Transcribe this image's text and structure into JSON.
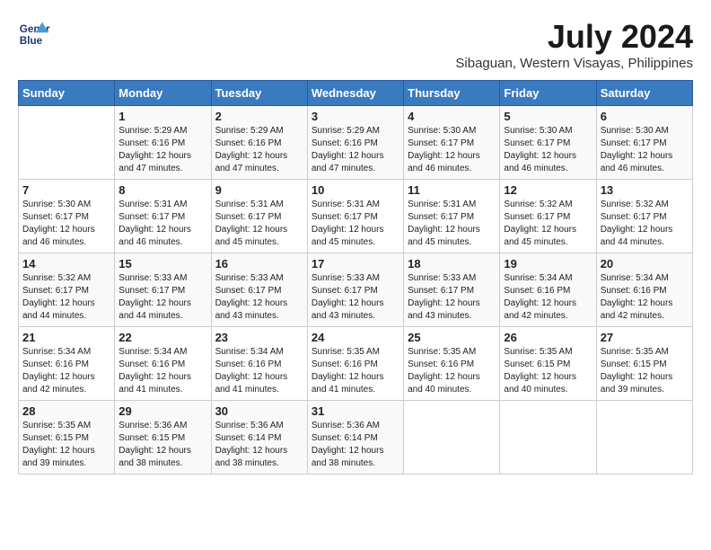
{
  "header": {
    "logo_line1": "General",
    "logo_line2": "Blue",
    "title": "July 2024",
    "subtitle": "Sibaguan, Western Visayas, Philippines"
  },
  "columns": [
    "Sunday",
    "Monday",
    "Tuesday",
    "Wednesday",
    "Thursday",
    "Friday",
    "Saturday"
  ],
  "weeks": [
    [
      {
        "day": "",
        "data": ""
      },
      {
        "day": "1",
        "data": "Sunrise: 5:29 AM\nSunset: 6:16 PM\nDaylight: 12 hours and 47 minutes."
      },
      {
        "day": "2",
        "data": "Sunrise: 5:29 AM\nSunset: 6:16 PM\nDaylight: 12 hours and 47 minutes."
      },
      {
        "day": "3",
        "data": "Sunrise: 5:29 AM\nSunset: 6:16 PM\nDaylight: 12 hours and 47 minutes."
      },
      {
        "day": "4",
        "data": "Sunrise: 5:30 AM\nSunset: 6:17 PM\nDaylight: 12 hours and 46 minutes."
      },
      {
        "day": "5",
        "data": "Sunrise: 5:30 AM\nSunset: 6:17 PM\nDaylight: 12 hours and 46 minutes."
      },
      {
        "day": "6",
        "data": "Sunrise: 5:30 AM\nSunset: 6:17 PM\nDaylight: 12 hours and 46 minutes."
      }
    ],
    [
      {
        "day": "7",
        "data": "Sunrise: 5:30 AM\nSunset: 6:17 PM\nDaylight: 12 hours and 46 minutes."
      },
      {
        "day": "8",
        "data": "Sunrise: 5:31 AM\nSunset: 6:17 PM\nDaylight: 12 hours and 46 minutes."
      },
      {
        "day": "9",
        "data": "Sunrise: 5:31 AM\nSunset: 6:17 PM\nDaylight: 12 hours and 45 minutes."
      },
      {
        "day": "10",
        "data": "Sunrise: 5:31 AM\nSunset: 6:17 PM\nDaylight: 12 hours and 45 minutes."
      },
      {
        "day": "11",
        "data": "Sunrise: 5:31 AM\nSunset: 6:17 PM\nDaylight: 12 hours and 45 minutes."
      },
      {
        "day": "12",
        "data": "Sunrise: 5:32 AM\nSunset: 6:17 PM\nDaylight: 12 hours and 45 minutes."
      },
      {
        "day": "13",
        "data": "Sunrise: 5:32 AM\nSunset: 6:17 PM\nDaylight: 12 hours and 44 minutes."
      }
    ],
    [
      {
        "day": "14",
        "data": "Sunrise: 5:32 AM\nSunset: 6:17 PM\nDaylight: 12 hours and 44 minutes."
      },
      {
        "day": "15",
        "data": "Sunrise: 5:33 AM\nSunset: 6:17 PM\nDaylight: 12 hours and 44 minutes."
      },
      {
        "day": "16",
        "data": "Sunrise: 5:33 AM\nSunset: 6:17 PM\nDaylight: 12 hours and 43 minutes."
      },
      {
        "day": "17",
        "data": "Sunrise: 5:33 AM\nSunset: 6:17 PM\nDaylight: 12 hours and 43 minutes."
      },
      {
        "day": "18",
        "data": "Sunrise: 5:33 AM\nSunset: 6:17 PM\nDaylight: 12 hours and 43 minutes."
      },
      {
        "day": "19",
        "data": "Sunrise: 5:34 AM\nSunset: 6:16 PM\nDaylight: 12 hours and 42 minutes."
      },
      {
        "day": "20",
        "data": "Sunrise: 5:34 AM\nSunset: 6:16 PM\nDaylight: 12 hours and 42 minutes."
      }
    ],
    [
      {
        "day": "21",
        "data": "Sunrise: 5:34 AM\nSunset: 6:16 PM\nDaylight: 12 hours and 42 minutes."
      },
      {
        "day": "22",
        "data": "Sunrise: 5:34 AM\nSunset: 6:16 PM\nDaylight: 12 hours and 41 minutes."
      },
      {
        "day": "23",
        "data": "Sunrise: 5:34 AM\nSunset: 6:16 PM\nDaylight: 12 hours and 41 minutes."
      },
      {
        "day": "24",
        "data": "Sunrise: 5:35 AM\nSunset: 6:16 PM\nDaylight: 12 hours and 41 minutes."
      },
      {
        "day": "25",
        "data": "Sunrise: 5:35 AM\nSunset: 6:16 PM\nDaylight: 12 hours and 40 minutes."
      },
      {
        "day": "26",
        "data": "Sunrise: 5:35 AM\nSunset: 6:15 PM\nDaylight: 12 hours and 40 minutes."
      },
      {
        "day": "27",
        "data": "Sunrise: 5:35 AM\nSunset: 6:15 PM\nDaylight: 12 hours and 39 minutes."
      }
    ],
    [
      {
        "day": "28",
        "data": "Sunrise: 5:35 AM\nSunset: 6:15 PM\nDaylight: 12 hours and 39 minutes."
      },
      {
        "day": "29",
        "data": "Sunrise: 5:36 AM\nSunset: 6:15 PM\nDaylight: 12 hours and 38 minutes."
      },
      {
        "day": "30",
        "data": "Sunrise: 5:36 AM\nSunset: 6:14 PM\nDaylight: 12 hours and 38 minutes."
      },
      {
        "day": "31",
        "data": "Sunrise: 5:36 AM\nSunset: 6:14 PM\nDaylight: 12 hours and 38 minutes."
      },
      {
        "day": "",
        "data": ""
      },
      {
        "day": "",
        "data": ""
      },
      {
        "day": "",
        "data": ""
      }
    ]
  ]
}
